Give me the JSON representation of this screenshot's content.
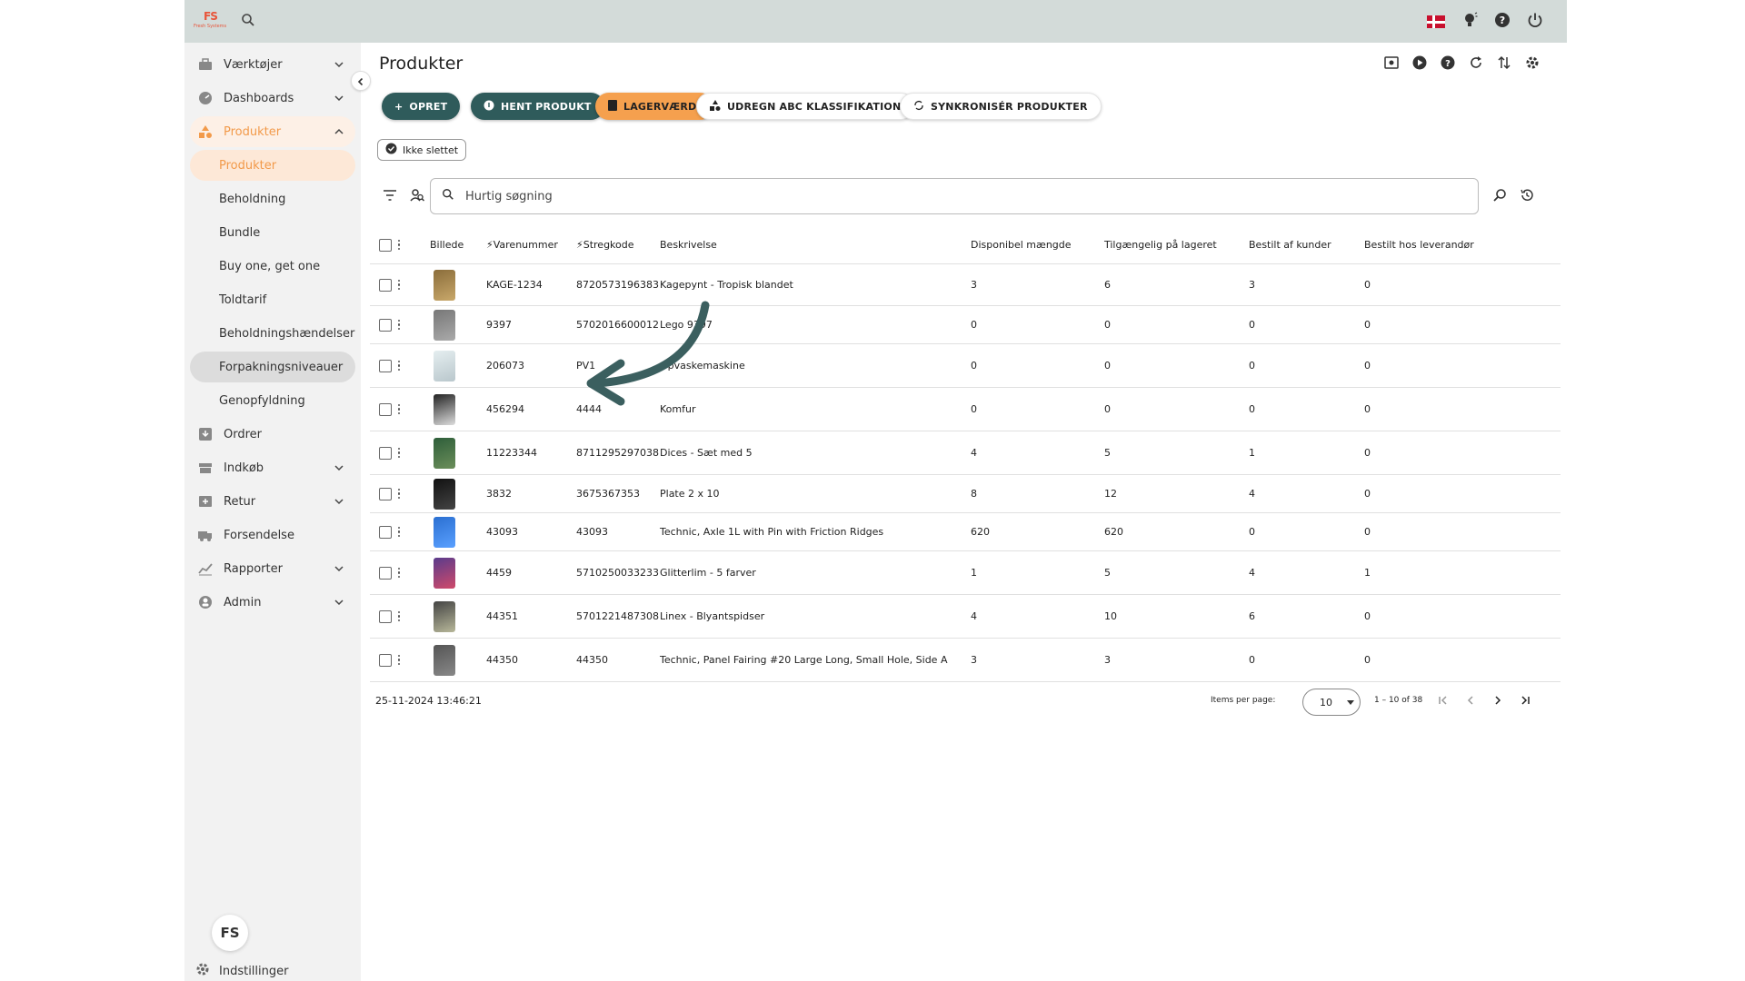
{
  "app": {
    "logo_text": "FS",
    "logo_sub": "Fresh Systems",
    "footer_logo": "FS",
    "settings_label": "Indstillinger",
    "language": "da"
  },
  "sidebar": {
    "items": [
      {
        "label": "Værktøjer",
        "icon": "toolbox-icon",
        "expandable": true
      },
      {
        "label": "Dashboards",
        "icon": "speedometer-icon",
        "expandable": true
      },
      {
        "label": "Produkter",
        "icon": "shapes-icon",
        "expandable": true,
        "expanded": true
      },
      {
        "label": "Produkter",
        "sub": true,
        "active": true
      },
      {
        "label": "Beholdning",
        "sub": true
      },
      {
        "label": "Bundle",
        "sub": true
      },
      {
        "label": "Buy one, get one",
        "sub": true
      },
      {
        "label": "Toldtarif",
        "sub": true
      },
      {
        "label": "Beholdningshændelser",
        "sub": true
      },
      {
        "label": "Forpakningsniveauer",
        "sub": true,
        "hover": true
      },
      {
        "label": "Genopfyldning",
        "sub": true
      },
      {
        "label": "Ordrer",
        "icon": "inbox-icon",
        "expandable": false
      },
      {
        "label": "Indkøb",
        "icon": "store-icon",
        "expandable": true
      },
      {
        "label": "Retur",
        "icon": "return-box-icon",
        "expandable": true
      },
      {
        "label": "Forsendelse",
        "icon": "truck-icon",
        "expandable": false
      },
      {
        "label": "Rapporter",
        "icon": "chart-icon",
        "expandable": true
      },
      {
        "label": "Admin",
        "icon": "admin-icon",
        "expandable": true
      }
    ]
  },
  "main": {
    "title": "Produkter",
    "buttons": {
      "opret": "OPRET",
      "hent": "HENT PRODUKT",
      "lagervaerdi": "LAGERVÆRDI",
      "abc": "UDREGN ABC KLASSIFIKATION",
      "sync": "SYNKRONISÉR PRODUKTER"
    },
    "filter_chip": "Ikke slettet",
    "search_placeholder": "Hurtig søgning",
    "colors": {
      "primary": "#2f5b5b",
      "accent": "#f5a04e",
      "active_text": "#f29a4a"
    }
  },
  "table": {
    "headers": {
      "image": "Billede",
      "sku": "Varenummer",
      "barcode": "Stregkode",
      "desc": "Beskrivelse",
      "available": "Disponibel mængde",
      "in_stock": "Tilgængelig på lageret",
      "ordered_customers": "Bestilt af kunder",
      "ordered_supplier": "Bestilt hos leverandør"
    },
    "rows": [
      {
        "sku": "KAGE-1234",
        "barcode": "8720573196383",
        "desc": "Kagepynt - Tropisk blandet",
        "available": "3",
        "in_stock": "6",
        "ordered_customers": "3",
        "ordered_supplier": "0"
      },
      {
        "sku": "9397",
        "barcode": "5702016600012",
        "desc": "Lego 9397",
        "available": "0",
        "in_stock": "0",
        "ordered_customers": "0",
        "ordered_supplier": "0"
      },
      {
        "sku": "206073",
        "barcode": "PV1",
        "desc": "Opvaskemaskine",
        "available": "0",
        "in_stock": "0",
        "ordered_customers": "0",
        "ordered_supplier": "0"
      },
      {
        "sku": "456294",
        "barcode": "4444",
        "desc": "Komfur",
        "available": "0",
        "in_stock": "0",
        "ordered_customers": "0",
        "ordered_supplier": "0"
      },
      {
        "sku": "11223344",
        "barcode": "8711295297038",
        "desc": "Dices - Sæt med 5",
        "available": "4",
        "in_stock": "5",
        "ordered_customers": "1",
        "ordered_supplier": "0"
      },
      {
        "sku": "3832",
        "barcode": "3675367353",
        "desc": "Plate 2 x 10",
        "available": "8",
        "in_stock": "12",
        "ordered_customers": "4",
        "ordered_supplier": "0"
      },
      {
        "sku": "43093",
        "barcode": "43093",
        "desc": "Technic, Axle 1L with Pin with Friction Ridges",
        "available": "620",
        "in_stock": "620",
        "ordered_customers": "0",
        "ordered_supplier": "0"
      },
      {
        "sku": "4459",
        "barcode": "5710250033233",
        "desc": "Glitterlim - 5 farver",
        "available": "1",
        "in_stock": "5",
        "ordered_customers": "4",
        "ordered_supplier": "1"
      },
      {
        "sku": "44351",
        "barcode": "5701221487308",
        "desc": "Linex - Blyantspidser",
        "available": "4",
        "in_stock": "10",
        "ordered_customers": "6",
        "ordered_supplier": "0"
      },
      {
        "sku": "44350",
        "barcode": "44350",
        "desc": "Technic, Panel Fairing #20 Large Long, Small Hole, Side A",
        "available": "3",
        "in_stock": "3",
        "ordered_customers": "0",
        "ordered_supplier": "0"
      }
    ],
    "timestamp": "25-11-2024 13:46:21",
    "items_per_page_label": "Items per page:",
    "items_per_page": "10",
    "range": "1 – 10 of 38"
  }
}
